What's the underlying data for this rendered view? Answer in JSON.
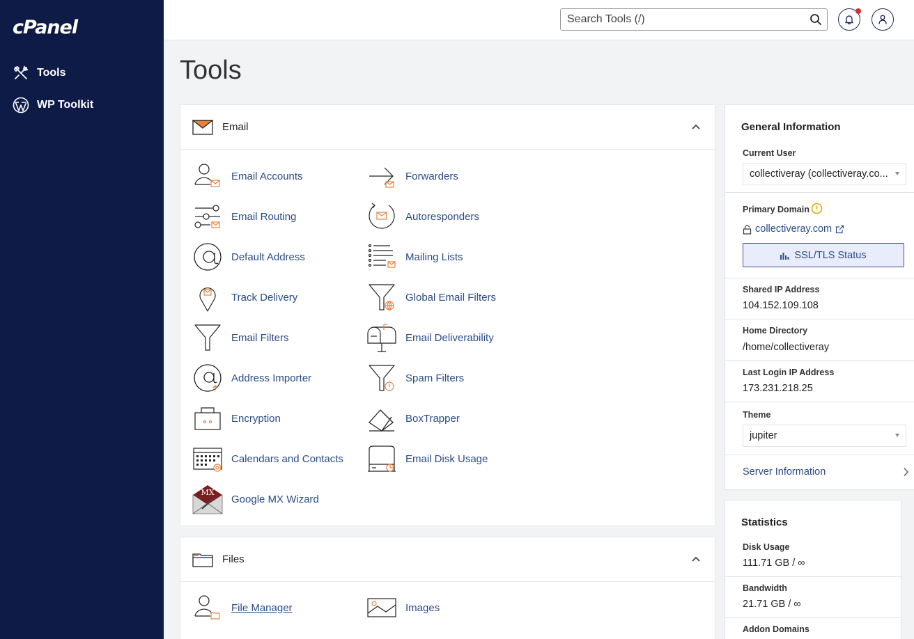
{
  "app": {
    "logo": "cPanel"
  },
  "sidebar": {
    "items": [
      {
        "label": "Tools",
        "icon": "tools-icon"
      },
      {
        "label": "WP Toolkit",
        "icon": "wordpress-icon"
      }
    ]
  },
  "header": {
    "search_placeholder": "Search Tools (/)",
    "notification_dot_color": "#d62f2f"
  },
  "page": {
    "title": "Tools"
  },
  "email_section": {
    "title": "Email",
    "tools": [
      {
        "label": "Email Accounts",
        "icon": "email-accounts-icon"
      },
      {
        "label": "Forwarders",
        "icon": "forwarders-icon"
      },
      {
        "label": "Email Routing",
        "icon": "email-routing-icon"
      },
      {
        "label": "Autoresponders",
        "icon": "autoresponders-icon"
      },
      {
        "label": "Default Address",
        "icon": "default-address-icon"
      },
      {
        "label": "Mailing Lists",
        "icon": "mailing-lists-icon"
      },
      {
        "label": "Track Delivery",
        "icon": "track-delivery-icon"
      },
      {
        "label": "Global Email Filters",
        "icon": "global-email-filters-icon"
      },
      {
        "label": "Email Filters",
        "icon": "email-filters-icon"
      },
      {
        "label": "Email Deliverability",
        "icon": "email-deliverability-icon"
      },
      {
        "label": "Address Importer",
        "icon": "address-importer-icon"
      },
      {
        "label": "Spam Filters",
        "icon": "spam-filters-icon"
      },
      {
        "label": "Encryption",
        "icon": "encryption-icon"
      },
      {
        "label": "BoxTrapper",
        "icon": "boxtrapper-icon"
      },
      {
        "label": "Calendars and Contacts",
        "icon": "calendars-contacts-icon"
      },
      {
        "label": "Email Disk Usage",
        "icon": "email-disk-usage-icon"
      },
      {
        "label": "Google MX Wizard",
        "icon": "google-mx-wizard-icon",
        "icon_text": "MX"
      }
    ]
  },
  "files_section": {
    "title": "Files",
    "tools": [
      {
        "label": "File Manager",
        "icon": "file-manager-icon"
      },
      {
        "label": "Images",
        "icon": "images-icon"
      }
    ]
  },
  "general_info": {
    "title": "General Information",
    "current_user_label": "Current User",
    "current_user_value": "collectiveray (collectiveray.co...",
    "primary_domain_label": "Primary Domain",
    "primary_domain_value": "collectiveray.com",
    "ssl_button": "SSL/TLS Status",
    "shared_ip_label": "Shared IP Address",
    "shared_ip_value": "104.152.109.108",
    "home_dir_label": "Home Directory",
    "home_dir_value": "/home/collectiveray",
    "last_login_label": "Last Login IP Address",
    "last_login_value": "173.231.218.25",
    "theme_label": "Theme",
    "theme_value": "jupiter",
    "server_info_link": "Server Information"
  },
  "statistics": {
    "title": "Statistics",
    "disk_usage_label": "Disk Usage",
    "disk_usage_value": "111.71 GB / ∞",
    "bandwidth_label": "Bandwidth",
    "bandwidth_value": "21.71 GB / ∞",
    "addon_domains_label": "Addon Domains"
  },
  "colors": {
    "sidebar_bg": "#0f1b47",
    "link": "#2b4b84",
    "accent_orange": "#e8823a",
    "warning": "#e0a800"
  }
}
